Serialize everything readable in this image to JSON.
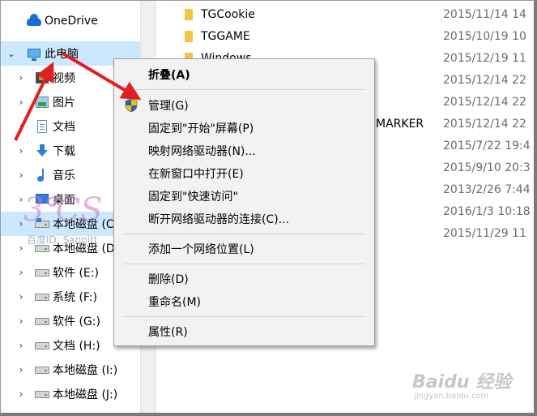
{
  "nav": {
    "items": [
      {
        "label": "OneDrive",
        "icon": "onedrive-cloud-icon"
      },
      {
        "label": "此电脑",
        "icon": "this-pc-icon"
      },
      {
        "label": "视频",
        "icon": "videos-folder-icon"
      },
      {
        "label": "图片",
        "icon": "pictures-folder-icon"
      },
      {
        "label": "文档",
        "icon": "documents-folder-icon"
      },
      {
        "label": "下载",
        "icon": "downloads-folder-icon"
      },
      {
        "label": "音乐",
        "icon": "music-folder-icon"
      },
      {
        "label": "桌面",
        "icon": "desktop-folder-icon"
      },
      {
        "label": "本地磁盘 (C",
        "icon": "drive-icon"
      },
      {
        "label": "本地磁盘 (D",
        "icon": "drive-icon"
      },
      {
        "label": "软件 (E:)",
        "icon": "drive-icon"
      },
      {
        "label": "系统 (F:)",
        "icon": "drive-icon"
      },
      {
        "label": "软件 (G:)",
        "icon": "drive-icon"
      },
      {
        "label": "文档 (H:)",
        "icon": "drive-icon"
      },
      {
        "label": "本地磁盘 (I:)",
        "icon": "drive-icon"
      },
      {
        "label": "本地磁盘 (J:)",
        "icon": "drive-icon"
      }
    ]
  },
  "files": {
    "rows": [
      {
        "name": "TGCookie",
        "date": "2015/11/14 14"
      },
      {
        "name": "TGGAME",
        "date": "2015/10/19 10"
      },
      {
        "name": "Windows",
        "date": "2015/12/19 11"
      },
      {
        "name": "",
        "date": "2015/12/14 22"
      },
      {
        "name": "",
        "date": "2015/12/14 22"
      },
      {
        "name": "MARKER",
        "date": "2015/12/14 22"
      },
      {
        "name": "",
        "date": "2015/7/22 19:4"
      },
      {
        "name": "",
        "date": "2015/9/10 20:3"
      },
      {
        "name": "",
        "date": "2013/2/26 7:44"
      },
      {
        "name": "",
        "date": "2016/1/3 10:18"
      },
      {
        "name": "",
        "date": "2015/11/29 11"
      }
    ]
  },
  "context_menu": {
    "collapse": "折叠(A)",
    "manage": "管理(G)",
    "pin_start": "固定到\"开始\"屏幕(P)",
    "map_drive": "映射网络驱动器(N)...",
    "open_new_window": "在新窗口中打开(E)",
    "pin_quick": "固定到\"快速访问\"",
    "disconnect_drive": "断开网络驱动器的连接(C)...",
    "add_network_location": "添加一个网络位置(L)",
    "delete": "删除(D)",
    "rename": "重命名(M)",
    "properties": "属性(R)"
  },
  "watermarks": {
    "logo_text": "3℃S",
    "baidu_id": "百度ID: Sanpitt",
    "baidu_logo": "Baidu 经验",
    "baidu_url": "jingyan.baidu.com"
  },
  "colors": {
    "selected_row": "#cce8ff",
    "menu_bg": "#f2f2f2",
    "arrow": "#e02020",
    "folder": "#f5c242"
  }
}
